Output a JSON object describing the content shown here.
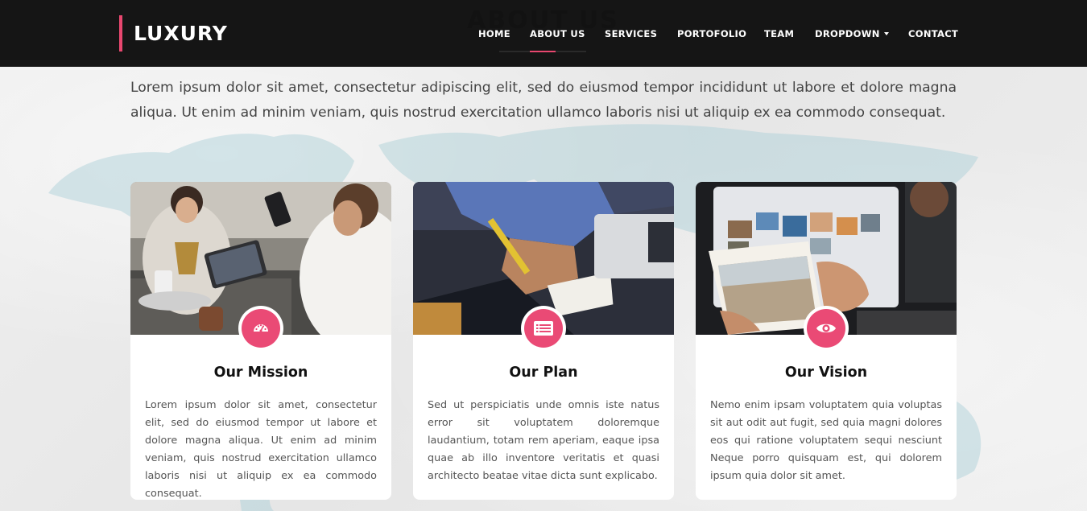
{
  "header": {
    "logo": "LUXURY",
    "nav": [
      {
        "label": "HOME"
      },
      {
        "label": "ABOUT US"
      },
      {
        "label": "SERVICES"
      },
      {
        "label": "PORTOFOLIO"
      },
      {
        "label": "TEAM"
      },
      {
        "label": "DROPDOWN"
      },
      {
        "label": "CONTACT"
      }
    ]
  },
  "section": {
    "heading": "ABOUT US",
    "intro": "Lorem ipsum dolor sit amet, consectetur adipiscing elit, sed do eiusmod tempor incididunt ut labore et dolore magna aliqua. Ut enim ad minim veniam, quis nostrud exercitation ullamco laboris nisi ut aliquip ex ea commodo consequat."
  },
  "cards": [
    {
      "title": "Our Mission",
      "icon": "dashboard-icon",
      "text": "Lorem ipsum dolor sit amet, consectetur elit, sed do eiusmod tempor ut labore et dolore magna aliqua. Ut enim ad minim veniam, quis nostrud exercitation ullamco laboris nisi ut aliquip ex ea commodo consequat."
    },
    {
      "title": "Our Plan",
      "icon": "list-icon",
      "text": "Sed ut perspiciatis unde omnis iste natus error sit voluptatem doloremque laudantium, totam rem aperiam, eaque ipsa quae ab illo inventore veritatis et quasi architecto beatae vitae dicta sunt explicabo."
    },
    {
      "title": "Our Vision",
      "icon": "eye-icon",
      "text": "Nemo enim ipsam voluptatem quia voluptas sit aut odit aut fugit, sed quia magni dolores eos qui ratione voluptatem sequi nesciunt Neque porro quisquam est, qui dolorem ipsum quia dolor sit amet."
    }
  ],
  "colors": {
    "accent": "#ea4a75",
    "navbar": "#151515",
    "background": "#ececec"
  }
}
